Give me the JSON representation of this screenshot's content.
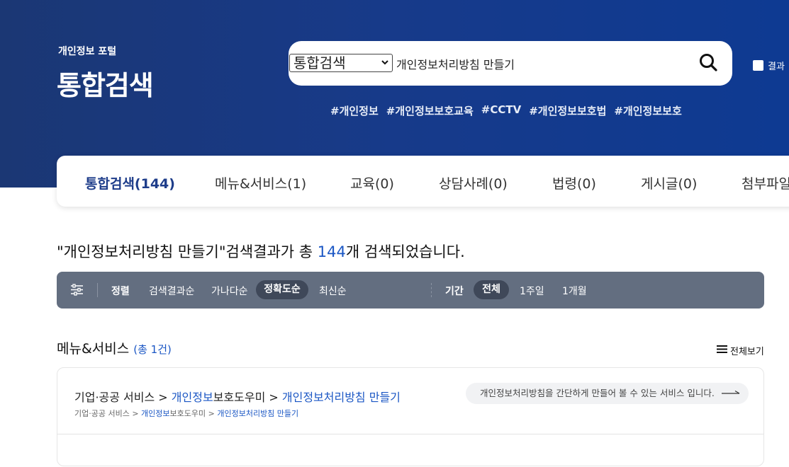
{
  "header": {
    "portal_label": "개인정보 포털",
    "page_title": "통합검색"
  },
  "search": {
    "select_value": "통합검색",
    "query": "개인정보처리방침 만들기",
    "search_icon": "search-icon",
    "result_within_label": "결과"
  },
  "tags": [
    "#개인정보",
    "#개인정보보호교육",
    "#CCTV",
    "#개인정보보호법",
    "#개인정보보호"
  ],
  "tabs": [
    {
      "label": "통합검색(144)"
    },
    {
      "label": "메뉴&서비스(1)"
    },
    {
      "label": "교육(0)"
    },
    {
      "label": "상담사례(0)"
    },
    {
      "label": "법령(0)"
    },
    {
      "label": "게시글(0)"
    },
    {
      "label": "첨부파일"
    }
  ],
  "summary": {
    "query_quoted": "\"개인정보처리방침 만들기\"",
    "text_before": "검색결과가 총 ",
    "count": "144",
    "text_after": "개 검색되었습니다."
  },
  "filter": {
    "icon": "sliders-icon",
    "sort_label": "정렬",
    "sort_options": [
      "검색결과순",
      "가나다순",
      "정확도순",
      "최신순"
    ],
    "sort_selected": "정확도순",
    "period_label": "기간",
    "period_options": [
      "전체",
      "1주일",
      "1개월"
    ],
    "period_selected": "전체"
  },
  "section": {
    "title": "메뉴&서비스",
    "count": "(총 1건)",
    "view_all": "전체보기",
    "view_all_icon": "menu-icon"
  },
  "result": {
    "crumb_main": {
      "part1": "기업·공공 서비스 > ",
      "hl1": "개인정보",
      "part2": "보호도우미 > ",
      "hl2": "개인정보처리방침 만들기"
    },
    "crumb_sub": {
      "part1": "기업·공공 서비스 > ",
      "hl1": "개인정보",
      "part2": "보호도우미 > ",
      "hl2": "개인정보처리방침 만들기"
    },
    "description": "개인정보처리방침을 간단하게 만들어 볼 수 있는 서비스 입니다.",
    "arrow_icon": "arrow-right-icon"
  }
}
